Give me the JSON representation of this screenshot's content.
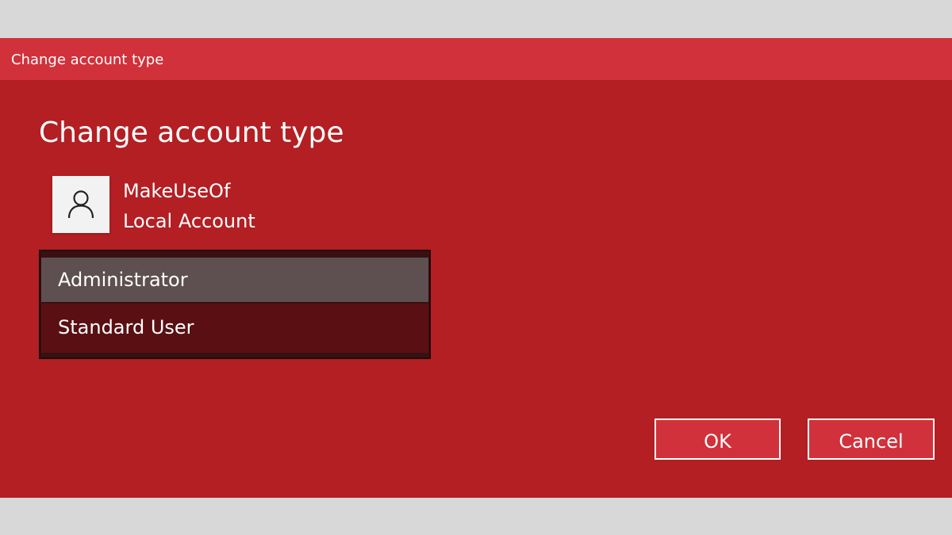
{
  "window": {
    "title": "Change account type"
  },
  "dialog": {
    "heading": "Change account type",
    "account": {
      "icon": "user-icon",
      "name": "MakeUseOf",
      "type": "Local Account"
    },
    "account_types": [
      {
        "label": "Administrator",
        "selected": true
      },
      {
        "label": "Standard User",
        "selected": false
      }
    ],
    "buttons": {
      "ok_label": "OK",
      "cancel_label": "Cancel"
    }
  },
  "colors": {
    "dialog_background": "#b31f23",
    "titlebar_background": "#d1313a",
    "selected_option": "#5e5050",
    "unselected_option": "#5a1013",
    "page_background": "#d8d8d8"
  }
}
